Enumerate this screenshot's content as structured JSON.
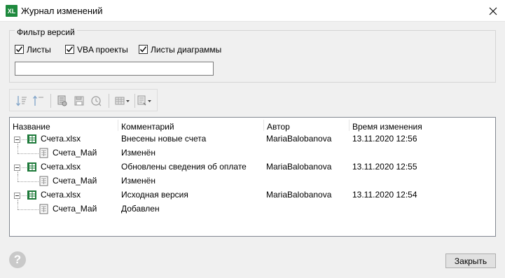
{
  "window": {
    "title": "Журнал изменений",
    "app_icon_text": "XL"
  },
  "filter": {
    "legend": "Фильтр версий",
    "checkboxes": [
      {
        "label": "Листы",
        "checked": true
      },
      {
        "label": "VBA проекты",
        "checked": true
      },
      {
        "label": "Листы диаграммы",
        "checked": true
      }
    ],
    "search_value": ""
  },
  "toolbar": {
    "icons": [
      "sort-descending-icon",
      "sort-ascending-icon",
      "compare-icon",
      "save-icon",
      "restore-version-icon",
      "view-options-icon",
      "export-icon"
    ]
  },
  "table": {
    "columns": [
      "Название",
      "Комментарий",
      "Автор",
      "Время изменения"
    ],
    "rows": [
      {
        "level": 0,
        "name": "Счета.xlsx",
        "comment": "Внесены новые счета",
        "author": "MariaBalobanova",
        "time": "13.11.2020 12:56"
      },
      {
        "level": 1,
        "name": "Счета_Май",
        "comment": "Изменён",
        "author": "",
        "time": ""
      },
      {
        "level": 0,
        "name": "Счета.xlsx",
        "comment": "Обновлены сведения об оплате",
        "author": "MariaBalobanova",
        "time": "13.11.2020 12:55"
      },
      {
        "level": 1,
        "name": "Счета_Май",
        "comment": "Изменён",
        "author": "",
        "time": ""
      },
      {
        "level": 0,
        "name": "Счета.xlsx",
        "comment": "Исходная версия",
        "author": "MariaBalobanova",
        "time": "13.11.2020 12:54"
      },
      {
        "level": 1,
        "name": "Счета_Май",
        "comment": "Добавлен",
        "author": "",
        "time": ""
      }
    ]
  },
  "footer": {
    "help_glyph": "?",
    "close_label": "Закрыть"
  },
  "colors": {
    "accent": "#1e8a3e",
    "window_bg": "#f0f0f0"
  }
}
